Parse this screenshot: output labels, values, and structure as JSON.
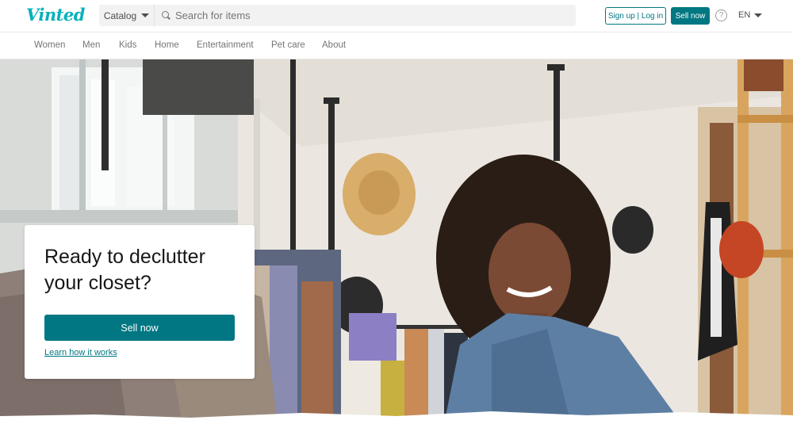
{
  "header": {
    "logo": "Vinted",
    "catalog_label": "Catalog",
    "search_placeholder": "Search for items",
    "signup_login_label": "Sign up | Log in",
    "sell_now_label": "Sell now",
    "help_glyph": "?",
    "language": "EN"
  },
  "nav": {
    "items": [
      {
        "label": "Women"
      },
      {
        "label": "Men"
      },
      {
        "label": "Kids"
      },
      {
        "label": "Home"
      },
      {
        "label": "Entertainment"
      },
      {
        "label": "Pet care"
      },
      {
        "label": "About"
      }
    ]
  },
  "hero": {
    "title": "Ready to declutter your closet?",
    "cta_label": "Sell now",
    "link_label": "Learn how it works"
  },
  "colors": {
    "brand": "#09b1ba",
    "accent": "#007782"
  },
  "icons": [
    "search-icon",
    "chevron-down-icon",
    "help-icon"
  ]
}
